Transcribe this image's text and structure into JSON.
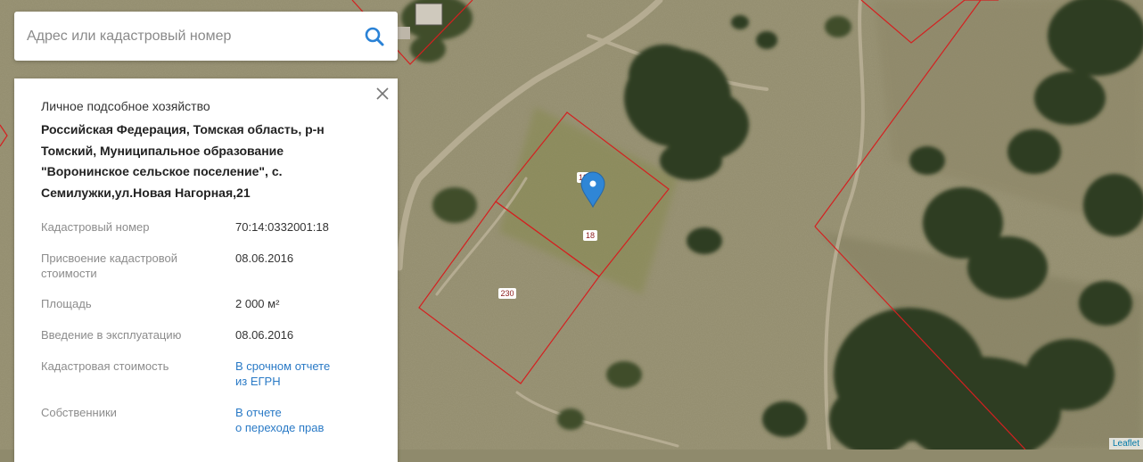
{
  "search": {
    "placeholder": "Адрес или кадастровый номер",
    "icon": "search-icon"
  },
  "panel": {
    "category": "Личное подсобное хозяйство",
    "address_lines": [
      "Российская Федерация, Томская область, р-н",
      "Томский, Муниципальное образование",
      "\"Воронинское сельское поселение\", с.",
      "Семилужки,ул.Новая Нагорная,21"
    ],
    "fields": [
      {
        "label": [
          "Кадастровый номер"
        ],
        "value": [
          "70:14:0332001:18"
        ],
        "link": false
      },
      {
        "label": [
          "Присвоение кадастровой",
          "стоимости"
        ],
        "value": [
          "08.06.2016"
        ],
        "link": false
      },
      {
        "label": [
          "Площадь"
        ],
        "value": [
          "2 000 м²"
        ],
        "link": false
      },
      {
        "label": [
          "Введение в эксплуатацию"
        ],
        "value": [
          "08.06.2016"
        ],
        "link": false
      },
      {
        "label": [
          "Кадастровая стоимость"
        ],
        "value": [
          "В срочном отчете",
          "из ЕГРН"
        ],
        "link": true
      },
      {
        "label": [
          "Собственники"
        ],
        "value": [
          "В отчете",
          "о переходе прав"
        ],
        "link": true
      }
    ]
  },
  "map": {
    "parcel_labels": [
      "18",
      "18",
      "230"
    ],
    "parcel_border_color": "#d42020",
    "marker_color": "#2f86d6"
  },
  "attribution": "Leaflet",
  "colors": {
    "link": "#2a7ac6",
    "search_icon": "#2a82d6"
  }
}
